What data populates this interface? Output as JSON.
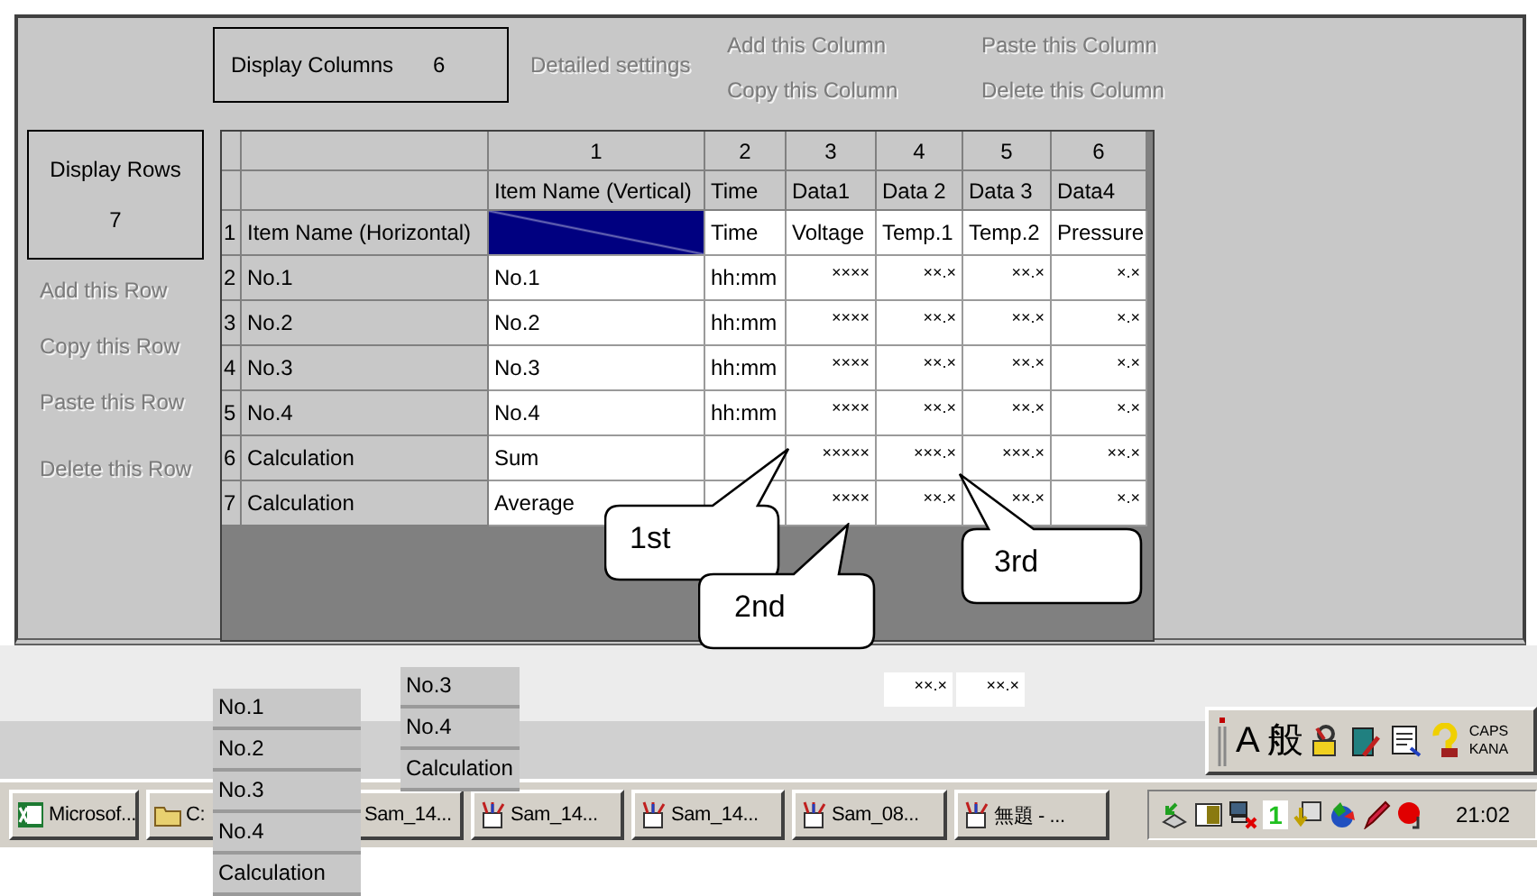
{
  "dialog": {
    "display_columns": {
      "label": "Display Columns",
      "value": "6"
    },
    "detailed_settings": {
      "label": "Detailed settings",
      "disabled": true
    },
    "column_actions": [
      {
        "label": "Add this Column",
        "disabled": true
      },
      {
        "label": "Paste this Column",
        "disabled": true
      },
      {
        "label": "Copy this Column",
        "disabled": true
      },
      {
        "label": "Delete this Column",
        "disabled": true
      }
    ],
    "display_rows": {
      "label": "Display Rows",
      "value": "7"
    },
    "row_actions": [
      {
        "label": "Add this Row",
        "disabled": true
      },
      {
        "label": "Copy this Row",
        "disabled": true
      },
      {
        "label": "Paste this Row",
        "disabled": true
      },
      {
        "label": "Delete this Row",
        "disabled": true
      }
    ],
    "grid": {
      "column_numbers": [
        "1",
        "2",
        "3",
        "4",
        "5",
        "6"
      ],
      "column_names": [
        "Item Name (Vertical)",
        "Time",
        "Data1",
        "Data 2",
        "Data 3",
        "Data4"
      ],
      "rows": [
        {
          "number": "1",
          "name": "Item Name (Horizontal)",
          "cells": [
            {
              "selected": true
            },
            {
              "text": "Time",
              "selected": false
            },
            {
              "text": "Voltage",
              "selected": false
            },
            {
              "text": "Temp.1",
              "selected": false
            },
            {
              "text": "Temp.2",
              "selected": false
            },
            {
              "text": "Pressure",
              "selected": false
            }
          ]
        },
        {
          "number": "2",
          "name": "No.1",
          "cells": [
            {
              "text": "No.1",
              "selected": false
            },
            {
              "text": "hh:mm",
              "selected": false
            },
            {
              "text": "××××",
              "selected": false
            },
            {
              "text": "××.×",
              "selected": false
            },
            {
              "text": "××.×",
              "selected": false
            },
            {
              "text": "×.×",
              "selected": false
            }
          ]
        },
        {
          "number": "3",
          "name": "No.2",
          "cells": [
            {
              "text": "No.2",
              "selected": false
            },
            {
              "text": "hh:mm",
              "selected": false
            },
            {
              "text": "××××",
              "selected": false
            },
            {
              "text": "××.×",
              "selected": false
            },
            {
              "text": "××.×",
              "selected": false
            },
            {
              "text": "×.×",
              "selected": false
            }
          ]
        },
        {
          "number": "4",
          "name": "No.3",
          "cells": [
            {
              "text": "No.3",
              "selected": false
            },
            {
              "text": "hh:mm",
              "selected": false
            },
            {
              "text": "××××",
              "selected": false
            },
            {
              "text": "××.×",
              "selected": false
            },
            {
              "text": "××.×",
              "selected": false
            },
            {
              "text": "×.×",
              "selected": false
            }
          ]
        },
        {
          "number": "5",
          "name": "No.4",
          "cells": [
            {
              "text": "No.4",
              "selected": false
            },
            {
              "text": "hh:mm",
              "selected": false
            },
            {
              "text": "××××",
              "selected": false
            },
            {
              "text": "××.×",
              "selected": false
            },
            {
              "text": "××.×",
              "selected": false
            },
            {
              "text": "×.×",
              "selected": false
            }
          ]
        },
        {
          "number": "6",
          "name": "Calculation",
          "cells": [
            {
              "text": "Sum",
              "selected": false
            },
            {
              "selected": false
            },
            {
              "text": "×××××",
              "selected": false
            },
            {
              "text": "×××.×",
              "selected": false
            },
            {
              "text": "×××.×",
              "selected": false
            },
            {
              "text": "××.×",
              "selected": false
            }
          ]
        },
        {
          "number": "7",
          "name": "Calculation",
          "cells": [
            {
              "text": "Average",
              "selected": false
            },
            {
              "selected": false
            },
            {
              "text": "××××",
              "selected": false
            },
            {
              "text": "××.×",
              "selected": false
            },
            {
              "text": "××.×",
              "selected": false
            },
            {
              "text": "×.×",
              "selected": false
            }
          ]
        }
      ]
    }
  },
  "callouts": [
    {
      "label": "1st"
    },
    {
      "label": "2nd"
    },
    {
      "label": "3rd"
    }
  ],
  "floating_cells": [
    "××.×",
    "××.×"
  ],
  "floating_lists": [
    {
      "items": [
        "No.1",
        "No.2",
        "No.3",
        "No.4",
        "Calculation"
      ]
    },
    {
      "items": [
        "No.3",
        "No.4",
        "Calculation"
      ]
    }
  ],
  "ime_toolbar": {
    "input_mode": "A",
    "conversion_mode": "般",
    "caps": "CAPS",
    "kana": "KANA"
  },
  "taskbar": {
    "buttons": [
      {
        "label": "Microsof...",
        "kind": "sheet"
      },
      {
        "label": "C:",
        "kind": "folder"
      },
      {
        "label": "Sam_14..."
      },
      {
        "label": "Sam_14...",
        "kind": "paint"
      },
      {
        "label": "Sam_14...",
        "kind": "paint"
      },
      {
        "label": "Sam_08...",
        "kind": "paint"
      },
      {
        "label": "無題 - ...",
        "kind": "paint"
      }
    ],
    "tray_indicator": "1",
    "clock": "21:02"
  }
}
